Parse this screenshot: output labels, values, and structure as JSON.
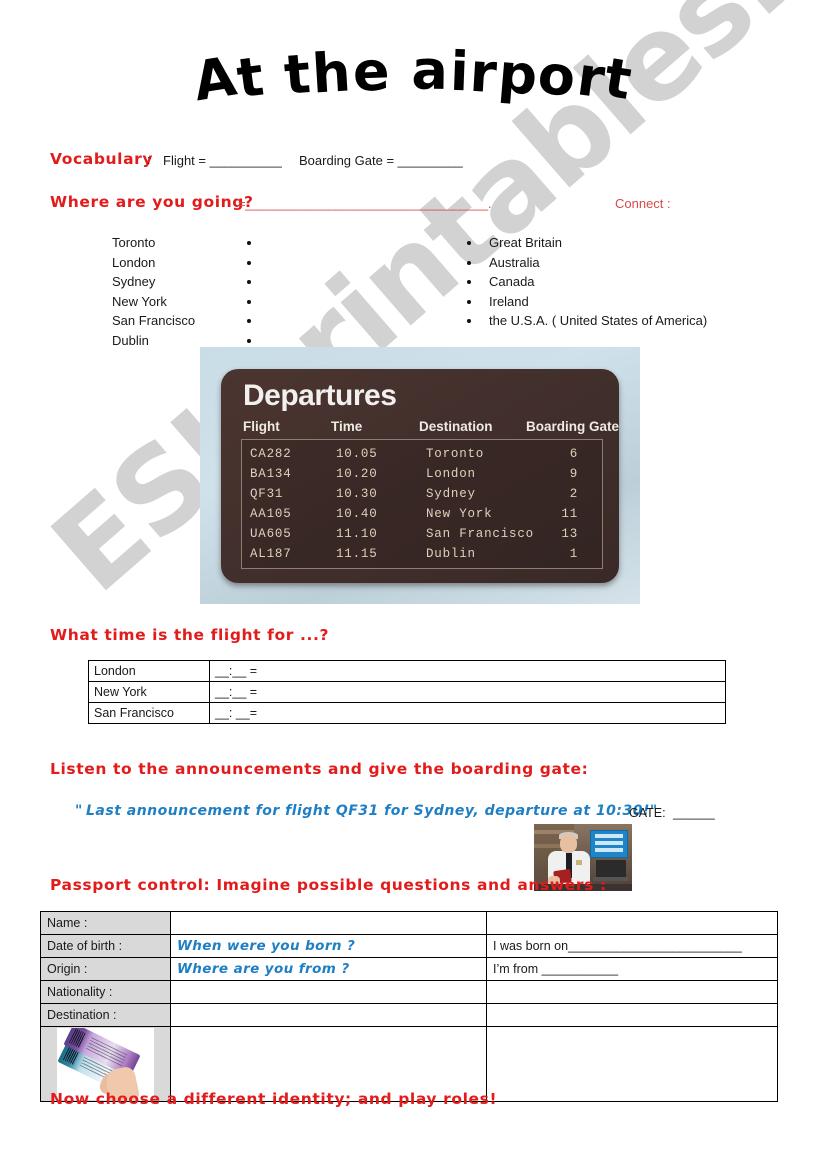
{
  "worksheet": {
    "title": "At the airport",
    "footer_note": "Now choose a different identity; and play roles!",
    "watermark": "ESLprintables.com"
  },
  "vocabulary": {
    "heading": "Vocabulary",
    "colon": ":",
    "item1": "Flight = __________",
    "item2": "Boarding Gate = _________"
  },
  "where_going": {
    "heading": "Where are you going?",
    "blank": "=___________________________________.",
    "connect_label": "Connect :"
  },
  "connect": {
    "left": [
      "Toronto",
      "London",
      "Sydney",
      "New York",
      "San Francisco",
      "Dublin"
    ],
    "right": [
      "Great Britain",
      "Australia",
      "Canada",
      "Ireland",
      "the U.S.A. ( United States of America)"
    ]
  },
  "departures": {
    "board_title": "Departures",
    "columns": [
      "Flight",
      "Time",
      "Destination",
      "Boarding Gate"
    ],
    "rows": [
      {
        "flight": "CA282",
        "time": "10.05",
        "destination": "Toronto",
        "gate": "6"
      },
      {
        "flight": "BA134",
        "time": "10.20",
        "destination": "London",
        "gate": "9"
      },
      {
        "flight": "QF31",
        "time": "10.30",
        "destination": "Sydney",
        "gate": "2"
      },
      {
        "flight": "AA105",
        "time": "10.40",
        "destination": "New York",
        "gate": "11"
      },
      {
        "flight": "UA605",
        "time": "11.10",
        "destination": "San Francisco",
        "gate": "13"
      },
      {
        "flight": "AL187",
        "time": "11.15",
        "destination": "Dublin",
        "gate": "1"
      }
    ]
  },
  "flight_time_task": {
    "heading": "What time is the flight for ...?",
    "rows": [
      {
        "city": "London",
        "answer": "__:__  ="
      },
      {
        "city": "New York",
        "answer": "__:__  ="
      },
      {
        "city": "San Francisco",
        "answer": "__: __="
      }
    ]
  },
  "announcement_task": {
    "heading": "Listen to the announcements and give the boarding gate:",
    "quote_open": "\"",
    "quote": "Last announcement for flight QF31 for Sydney, departure at 10:30!\"",
    "gate_label": "GATE:",
    "gate_blank": "______"
  },
  "passport_task": {
    "heading": "Passport control: Imagine possible questions and answers :",
    "rows": [
      {
        "label": "Name :",
        "question": "",
        "answer": ""
      },
      {
        "label": "Date of birth :",
        "question": "When were you born ?",
        "answer": "I was born on_________________________"
      },
      {
        "label": "Origin :",
        "question": "Where are you from ?",
        "answer": "I’m from ___________"
      },
      {
        "label": "Nationality :",
        "question": "",
        "answer": ""
      },
      {
        "label": "Destination :",
        "question": "",
        "answer": ""
      }
    ]
  },
  "images": {
    "departures_board": "departures-board-photo",
    "immigration_officer": "immigration-officer-photo",
    "boarding_passes": "boarding-passes-photo"
  },
  "colors": {
    "heading_red": "#e21b1b",
    "accent_blue": "#1f7fc4",
    "table_label_gray": "#d9d9d9",
    "watermark_gray": "#d2d2d2"
  }
}
